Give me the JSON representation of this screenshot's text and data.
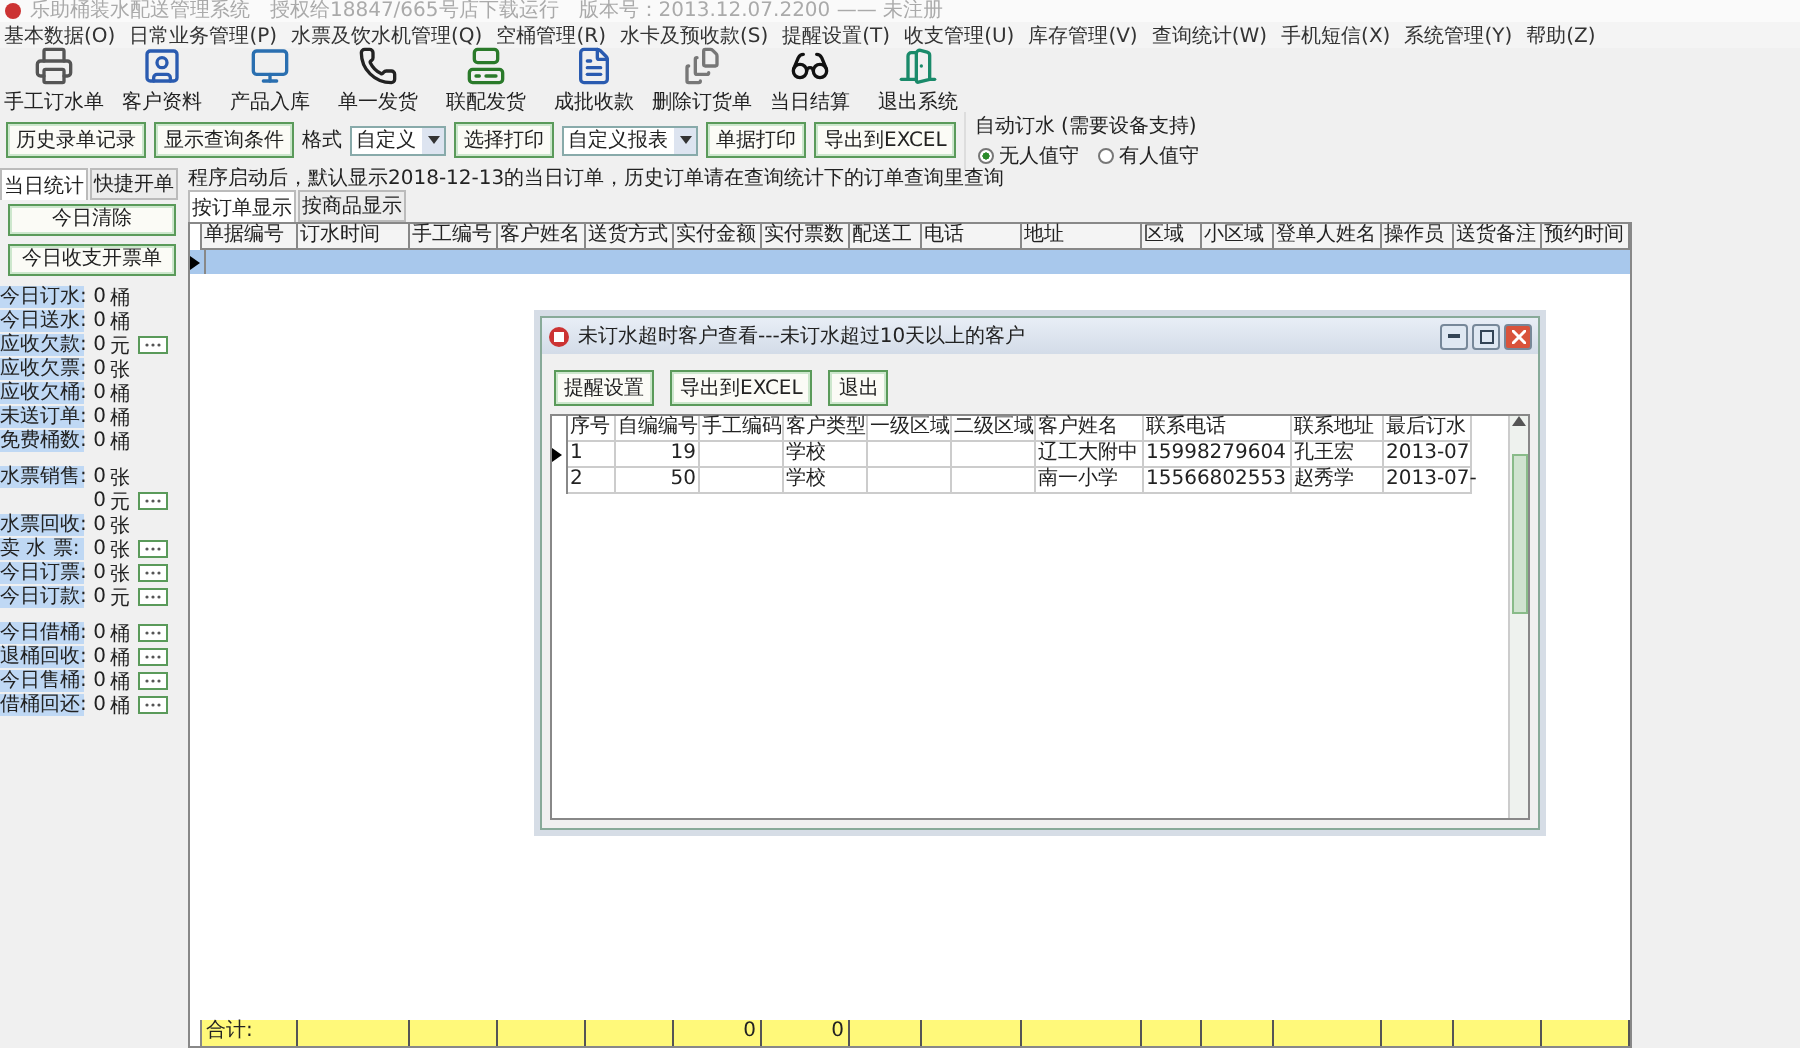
{
  "window": {
    "title": "乐助桶装水配送管理系统　授权给18847/665号店下载运行　版本号：2013.12.07.2200 —— 未注册"
  },
  "menu": [
    "基本数据(O)",
    "日常业务管理(P)",
    "水票及饮水机管理(Q)",
    "空桶管理(R)",
    "水卡及预收款(S)",
    "提醒设置(T)",
    "收支管理(U)",
    "库存管理(V)",
    "查询统计(W)",
    "手机短信(X)",
    "系统管理(Y)",
    "帮助(Z)"
  ],
  "toolbar": [
    "手工订水单",
    "客户资料",
    "产品入库",
    "单一发货",
    "联配发货",
    "成批收款",
    "删除订货单",
    "当日结算",
    "退出系统"
  ],
  "actions": {
    "history": "历史录单记录",
    "show_query": "显示查询条件",
    "format_label": "格式",
    "format_value": "自定义",
    "select_print": "选择打印",
    "report_value": "自定义报表",
    "bill_print": "单据打印",
    "export": "导出到EXCEL"
  },
  "auto_order": {
    "title": "自动订水 (需要设备支持)",
    "options": [
      {
        "label": "无人值守",
        "selected": true
      },
      {
        "label": "有人值守",
        "selected": false
      }
    ]
  },
  "left_tabs": [
    {
      "label": "当日统计",
      "selected": true
    },
    {
      "label": "快捷开单",
      "selected": false
    }
  ],
  "left_buttons": [
    "今日清除",
    "今日收支开票单"
  ],
  "stat_groups": [
    [
      {
        "label": "今日订水:",
        "value": "0",
        "unit": "桶",
        "has_button": false
      },
      {
        "label": "今日送水:",
        "value": "0",
        "unit": "桶",
        "has_button": false
      },
      {
        "label": "应收欠款:",
        "value": "0",
        "unit": "元",
        "has_button": true
      },
      {
        "label": "应收欠票:",
        "value": "0",
        "unit": "张",
        "has_button": false
      },
      {
        "label": "应收欠桶:",
        "value": "0",
        "unit": "桶",
        "has_button": false
      },
      {
        "label": "未送订单:",
        "value": "0",
        "unit": "桶",
        "has_button": false
      },
      {
        "label": "免费桶数:",
        "value": "0",
        "unit": "桶",
        "has_button": false
      }
    ],
    [
      {
        "label": "水票销售:",
        "value": "0",
        "unit": "张",
        "has_button": false
      },
      {
        "value": "0",
        "unit": "元",
        "has_button": true
      },
      {
        "label": "水票回收:",
        "value": "0",
        "unit": "张",
        "has_button": false
      },
      {
        "label": "卖 水 票:",
        "value": "0",
        "unit": "张",
        "has_button": true
      },
      {
        "label": "今日订票:",
        "value": "0",
        "unit": "张",
        "has_button": true
      },
      {
        "label": "今日订款:",
        "value": "0",
        "unit": "元",
        "has_button": true
      }
    ],
    [
      {
        "label": "今日借桶:",
        "value": "0",
        "unit": "桶",
        "has_button": true
      },
      {
        "label": "退桶回收:",
        "value": "0",
        "unit": "桶",
        "has_button": true
      },
      {
        "label": "今日售桶:",
        "value": "0",
        "unit": "桶",
        "has_button": true
      },
      {
        "label": "借桶回还:",
        "value": "0",
        "unit": "桶",
        "has_button": true
      }
    ]
  ],
  "notice": "程序启动后，默认显示2018-12-13的当日订单，历史订单请在查询统计下的订单查询里查询",
  "view_tabs": [
    {
      "label": "按订单显示",
      "selected": true
    },
    {
      "label": "按商品显示",
      "selected": false
    }
  ],
  "table": {
    "columns": [
      "单据编号",
      "订水时间",
      "手工编号",
      "客户姓名",
      "送货方式",
      "实付金额",
      "实付票数",
      "配送工",
      "电话",
      "地址",
      "区域",
      "小区域",
      "登单人姓名",
      "操作员",
      "送货备注",
      "预约时间"
    ],
    "footer": {
      "label": "合计:",
      "amount_total": "0",
      "ticket_total": "0"
    }
  },
  "dialog": {
    "title": "未订水超时客户查看---未订水超过10天以上的客户",
    "buttons": [
      "提醒设置",
      "导出到EXCEL",
      "退出"
    ],
    "columns": [
      "序号",
      "自编编号",
      "手工编码",
      "客户类型",
      "一级区域",
      "二级区域",
      "客户姓名",
      "联系电话",
      "联系地址",
      "最后订水"
    ],
    "rows": [
      {
        "selected": true,
        "cells": [
          "1",
          "19",
          "",
          "学校",
          "",
          "",
          "辽工大附中",
          "15998279604",
          "孔王宏",
          "2013-07"
        ]
      },
      {
        "selected": false,
        "cells": [
          "2",
          "50",
          "",
          "学校",
          "",
          "",
          "南一小学",
          "15566802553",
          "赵秀学",
          "2013-07-"
        ]
      }
    ]
  }
}
